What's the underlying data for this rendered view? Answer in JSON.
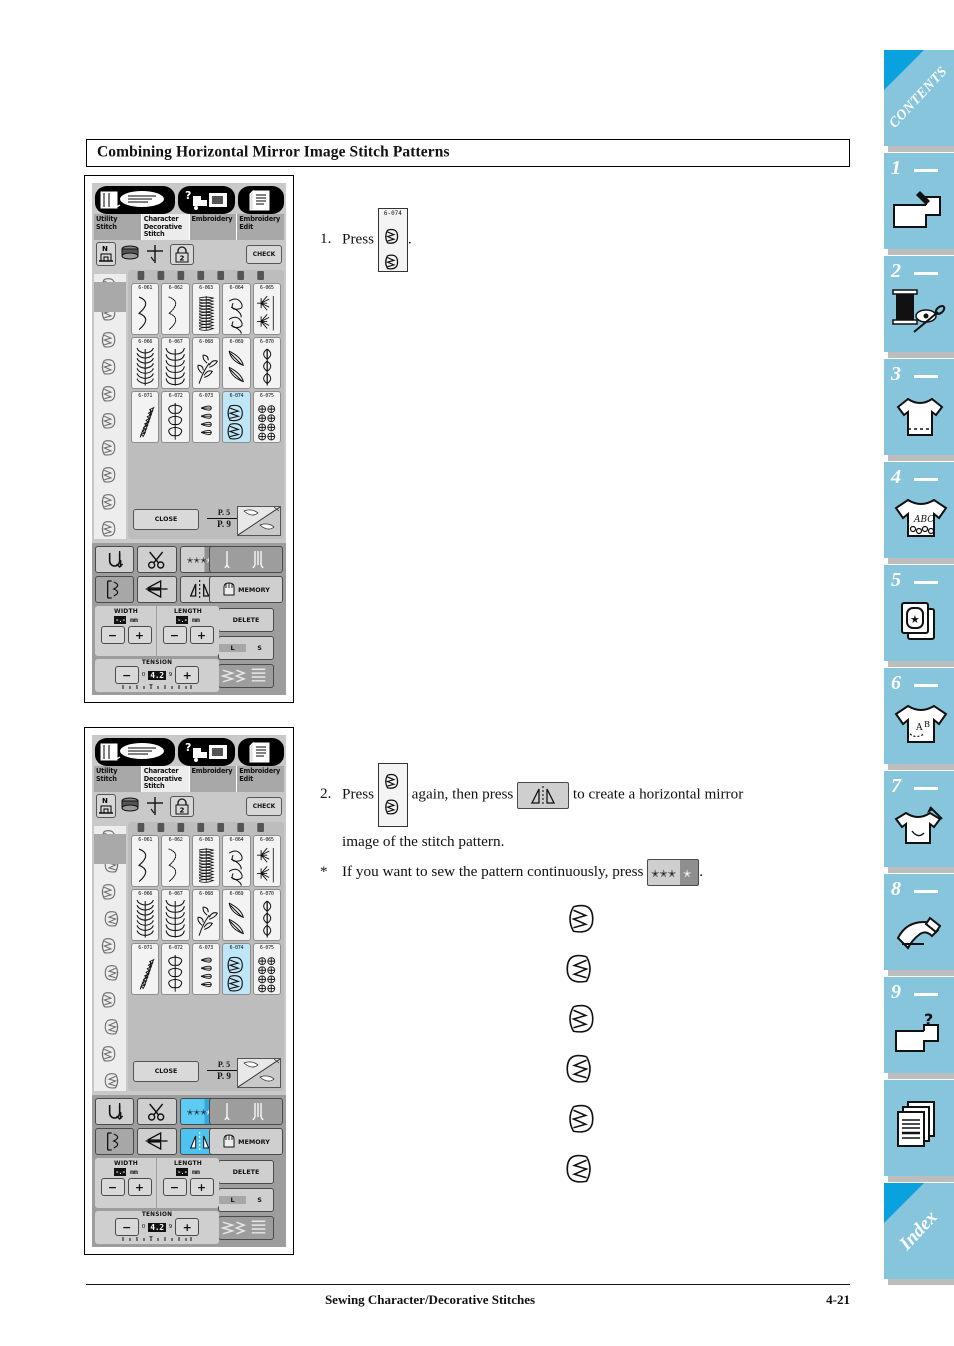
{
  "document": {
    "section_heading": "Combining Horizontal Mirror Image Stitch Patterns",
    "footer_title": "Sewing Character/Decorative Stitches",
    "footer_page": "4-21"
  },
  "steps": {
    "step1": {
      "number": "1.",
      "text_before": "Press",
      "text_after": "."
    },
    "step2": {
      "number": "2.",
      "text_a": "Press",
      "text_b": "again, then press",
      "text_c": "to create a horizontal mirror",
      "text_d": "image of the stitch pattern.",
      "note_marker": "*",
      "note_a": "If you want to sew the pattern continuously, press",
      "note_b": "."
    }
  },
  "machine_screen": {
    "icon_buttons": [
      {
        "name": "utility-stitch-icon"
      },
      {
        "name": "guide-help-icon"
      },
      {
        "name": "manual-page-icon"
      }
    ],
    "tabs": [
      {
        "label": "Utility\nStitch",
        "active": false
      },
      {
        "label": "Character\nDecorative\nStitch",
        "active": true
      },
      {
        "label": "Embroidery",
        "active": false
      },
      {
        "label": "Embroidery\nEdit",
        "active": false
      }
    ],
    "status_buttons": {
      "presser_foot": "N",
      "check_label": "CHECK"
    },
    "pattern_grid": {
      "rows": [
        [
          "6-061",
          "6-062",
          "6-063",
          "6-064",
          "6-065"
        ],
        [
          "6-066",
          "6-067",
          "6-068",
          "6-069",
          "6-070"
        ],
        [
          "6-071",
          "6-072",
          "6-073",
          "6-074",
          "6-075"
        ]
      ],
      "selected": "6-074"
    },
    "close_label": "CLOSE",
    "page_current": "P. 5",
    "page_total": "P. 9",
    "controls": {
      "reinforcement": "reinforcement-stitch-icon",
      "thread_cutter": "thread-cutter-icon",
      "continuous": "continuous-sewing-icon",
      "elongation": "stitch-elongation-icon",
      "vertical_mirror": "vertical-mirror-icon",
      "horizontal_mirror": "horizontal-mirror-icon",
      "needle_mode": "single-twin-needle-icon",
      "memory_label": "MEMORY",
      "delete_label": "DELETE",
      "size_large": "L",
      "size_small": "S",
      "speed": "sewing-speed-icon"
    },
    "width": {
      "label": "WIDTH",
      "value": "-.-",
      "unit": "mm"
    },
    "length": {
      "label": "LENGTH",
      "value": "-.-",
      "unit": "mm"
    },
    "tension": {
      "label": "TENSION",
      "value": "4.2",
      "min": "0",
      "max": "9"
    },
    "minus": "−",
    "plus": "+"
  },
  "panel_states": {
    "panel1": {
      "continuous_on": false,
      "mirror_on": false
    },
    "panel2": {
      "continuous_on": true,
      "mirror_on": true
    }
  },
  "inline_keys": {
    "stitch_label": "6-074"
  },
  "side_tabs": [
    {
      "name": "contents",
      "number": "",
      "label": "CONTENTS",
      "icon": "corner-tab"
    },
    {
      "name": "chapter-1",
      "number": "1",
      "label": "",
      "icon": "sewing-machine-icon"
    },
    {
      "name": "chapter-2",
      "number": "2",
      "label": "",
      "icon": "thread-spool-scissors-icon"
    },
    {
      "name": "chapter-3",
      "number": "3",
      "label": "",
      "icon": "tshirt-hem-icon"
    },
    {
      "name": "chapter-4",
      "number": "4",
      "label": "",
      "icon": "tshirt-abc-icon"
    },
    {
      "name": "chapter-5",
      "number": "5",
      "label": "",
      "icon": "embroidery-hoop-star-icon"
    },
    {
      "name": "chapter-6",
      "number": "6",
      "label": "",
      "icon": "tshirt-monogram-icon"
    },
    {
      "name": "chapter-7",
      "number": "7",
      "label": "",
      "icon": "tshirt-needle-icon"
    },
    {
      "name": "chapter-8",
      "number": "8",
      "label": "",
      "icon": "maintenance-icon"
    },
    {
      "name": "chapter-9",
      "number": "9",
      "label": "",
      "icon": "troubleshooting-icon"
    },
    {
      "name": "appendix",
      "number": "",
      "label": "",
      "icon": "pages-stack-icon"
    },
    {
      "name": "index",
      "number": "",
      "label": "Index",
      "icon": "corner-tab"
    }
  ],
  "colors": {
    "tab_blue": "#87c5dc",
    "tab_corner_blue": "#0aa2de",
    "lcd_gray": "#c9c9c9",
    "selected_cell": "#bfe6f7",
    "active_button": "#4ec3f0"
  }
}
